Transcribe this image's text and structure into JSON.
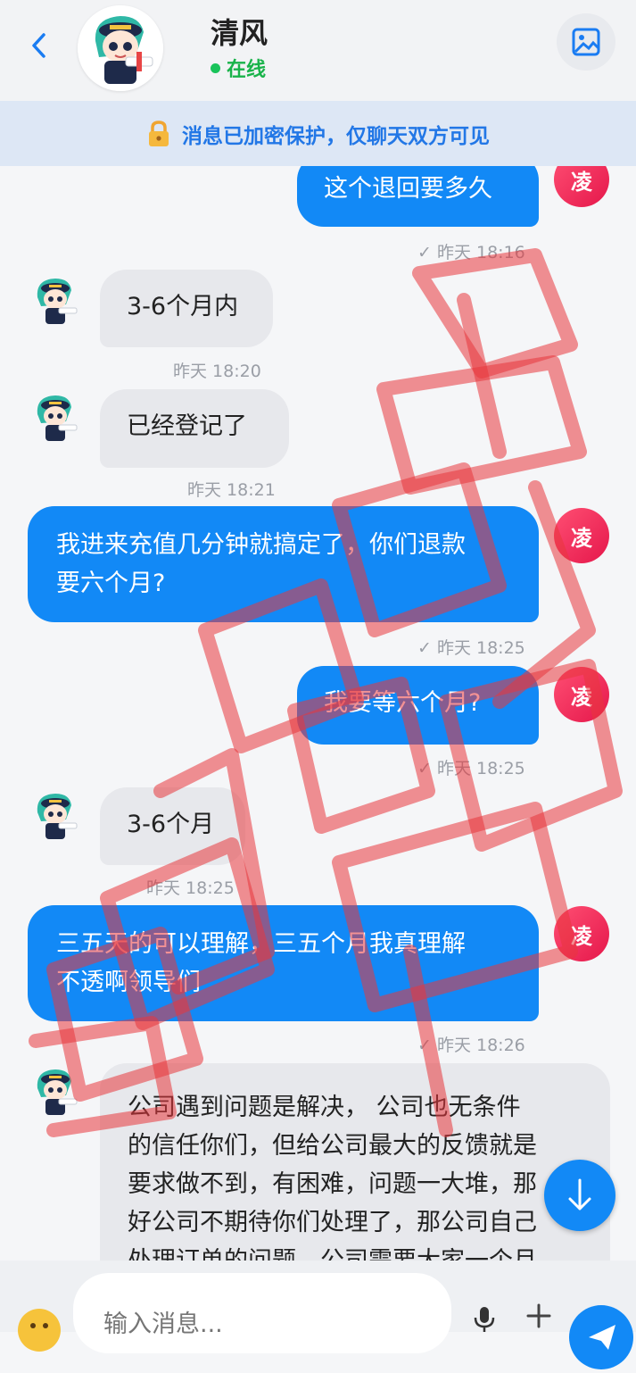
{
  "header": {
    "back_icon": "chevron-left-icon",
    "contact_name": "清风",
    "status": "在线",
    "image_icon": "image-icon"
  },
  "banner": {
    "icon": "lock-icon",
    "text": "消息已加密保护，仅聊天双方可见"
  },
  "my_avatar_label": "凌",
  "messages": [
    {
      "from": "me",
      "text": "这个退回要多久",
      "time": "✓ 昨天 18:16"
    },
    {
      "from": "them",
      "text": "3-6个月内",
      "time": "昨天 18:20"
    },
    {
      "from": "them",
      "text": "已经登记了",
      "time": "昨天 18:21"
    },
    {
      "from": "me",
      "text_line1": "我进来充值几分钟就搞定了，你们退款",
      "text_line2": "要六个月?",
      "time": "✓ 昨天 18:25"
    },
    {
      "from": "me",
      "text": "我要等六个月?",
      "time": "✓ 昨天 18:25"
    },
    {
      "from": "them",
      "text": "3-6个月",
      "time": "昨天 18:25"
    },
    {
      "from": "me",
      "text_line1": "三五天的可以理解，三五个月我真理解",
      "text_line2": "不透啊领导们",
      "time": "✓ 昨天 18:26"
    },
    {
      "from": "them",
      "lines": [
        "公司遇到问题是解决， 公司也无条件",
        "的信任你们，但给公司最大的反馈就是",
        "要求做不到，有困难，问题一大堆，那",
        "好公司不期待你们处理了，那公司自己",
        "处理订单的问题，公司需要大家一个月"
      ]
    }
  ],
  "input": {
    "placeholder": "输入消息..."
  },
  "colors": {
    "accent": "#1289f6",
    "online": "#19c35a",
    "avatar_me": "#e5174b",
    "bubble_them": "#e7e8ec",
    "watermark": "#e8363c"
  }
}
